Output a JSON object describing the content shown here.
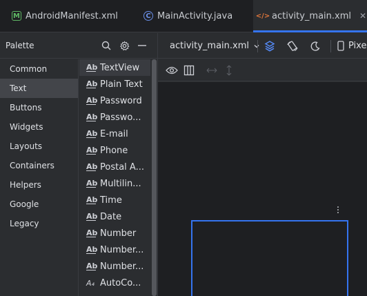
{
  "tabs": [
    {
      "label": "AndroidManifest.xml",
      "icon": "manifest-file-icon",
      "active": false
    },
    {
      "label": "MainActivity.java",
      "icon": "java-class-icon",
      "active": false
    },
    {
      "label": "activity_main.xml",
      "icon": "xml-layout-icon",
      "active": true
    }
  ],
  "palette": {
    "title": "Palette",
    "categories": [
      "Common",
      "Text",
      "Buttons",
      "Widgets",
      "Layouts",
      "Containers",
      "Helpers",
      "Google",
      "Legacy"
    ],
    "selected_category": "Text",
    "widgets": [
      "TextView",
      "Plain Text",
      "Password",
      "Passwo...",
      "E-mail",
      "Phone",
      "Postal A...",
      "Multilin...",
      "Time",
      "Date",
      "Number",
      "Number...",
      "Number...",
      "AutoCo..."
    ],
    "widget_icon_text": "Ab",
    "autocomplete_icon_text": "A₄",
    "selected_widget": "TextView"
  },
  "toolbar": {
    "file_label": "activity_main.xml",
    "device_label": "Pixel"
  },
  "colors": {
    "accent": "#3574f0",
    "xml_icon": "#e0763a",
    "manifest_icon": "#5fb865",
    "java_icon": "#6a8fe8"
  }
}
